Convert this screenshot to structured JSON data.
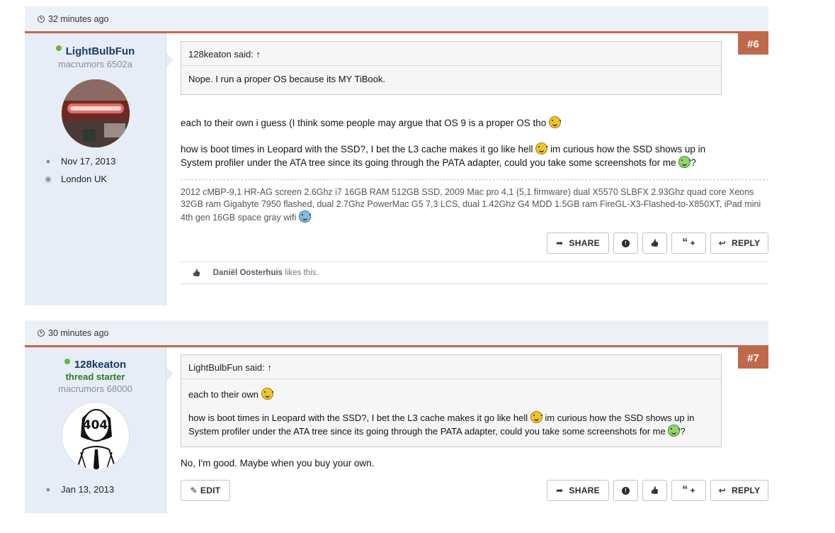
{
  "posts": [
    {
      "time": "32 minutes ago",
      "number": "#6",
      "user": {
        "name": "LightBulbFun",
        "title": "macrumors 6502a",
        "joined": "Nov 17, 2013",
        "location": "London UK"
      },
      "quote": {
        "author": "128keaton said: ↑",
        "lines": [
          "Nope. I run a proper OS because its MY TiBook."
        ]
      },
      "message": {
        "p1": "each to their own i guess (I think some people may argue that OS 9 is a proper OS tho",
        "p2a": "how is boot times in Leopard with the SSD?, I bet the L3 cache makes it go like hell",
        "p2b": "im curious how the SSD shows up in System profiler under the ATA tree since its going through the PATA adapter, could you take some screenshots for me",
        "p2c": "?"
      },
      "signature": "2012 cMBP-9,1 HR-AG screen 2.6Ghz i7 16GB RAM 512GB SSD, 2009 Mac pro 4,1 (5,1 firmware) dual X5570 SLBFX 2.93Ghz quad core Xeons 32GB ram Gigabyte 7950 flashed, dual 2.7Ghz PowerMac G5 7,3 LCS, dual 1.42Ghz G4 MDD 1.5GB ram FireGL-X3-Flashed-to-X850XT, iPad mini 4th gen 16GB space gray wifi",
      "likes": {
        "who": "Daniël Oosterhuis",
        "text": " likes this."
      }
    },
    {
      "time": "30 minutes ago",
      "number": "#7",
      "user": {
        "name": "128keaton",
        "badge": "thread starter",
        "title": "macrumors 68000",
        "joined": "Jan 13, 2013",
        "avatar_text": "404"
      },
      "quote": {
        "author": "LightBulbFun said: ↑",
        "l1": "each to their own",
        "l2a": "how is boot times in Leopard with the SSD?, I bet the L3 cache makes it go like hell",
        "l2b": "im curious how the SSD shows up in System profiler under the ATA tree since its going through the PATA adapter, could you take some screenshots for me",
        "l2c": "?"
      },
      "message": "No, I'm good. Maybe when you buy your own."
    }
  ],
  "buttons": {
    "share": "SHARE",
    "report_icon": "!",
    "like_icon": "👍",
    "quote": "+",
    "reply": "REPLY",
    "edit": "EDIT"
  },
  "icons": {
    "clock": "clock-icon",
    "user": "user-icon",
    "location": "map-pin-icon",
    "share": "share-icon",
    "report": "report-icon",
    "like": "thumbs-up-icon",
    "quote": "quote-icon",
    "reply": "reply-icon",
    "edit": "pencil-icon"
  },
  "colors": {
    "accent": "#c0694a",
    "header_bg": "#ecf1f8",
    "user_bg": "#e6edf7",
    "online": "#6bb53a",
    "username": "#1b3a63",
    "thread_starter": "#2f7a2a"
  }
}
